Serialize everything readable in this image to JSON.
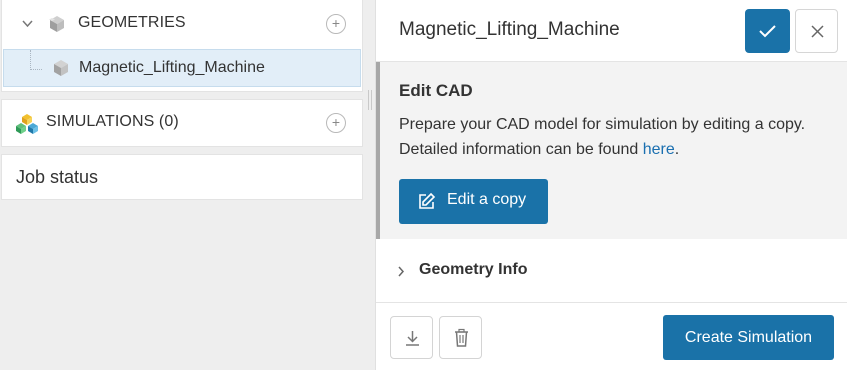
{
  "tree": {
    "geometries": {
      "label": "GEOMETRIES",
      "items": [
        {
          "label": "Magnetic_Lifting_Machine"
        }
      ]
    },
    "simulations": {
      "label": "SIMULATIONS (0)"
    },
    "job_status": {
      "label": "Job status"
    }
  },
  "panel": {
    "title": "Magnetic_Lifting_Machine",
    "edit_cad": {
      "title": "Edit CAD",
      "description": "Prepare your CAD model for simulation by editing a copy. Detailed information can be found ",
      "link_text": "here",
      "description_end": ".",
      "button_label": "Edit a copy"
    },
    "geometry_info": {
      "label": "Geometry Info"
    },
    "footer": {
      "create_label": "Create Simulation"
    }
  },
  "icons": {
    "confirm": "check-icon",
    "close": "close-icon",
    "download": "download-icon",
    "delete": "trash-icon",
    "edit": "edit-icon",
    "add": "plus-icon",
    "geometry": "cube-icon",
    "simulation": "simulation-cubes-icon"
  },
  "colors": {
    "primary": "#1a72a8",
    "link": "#1a6fb0",
    "selected_row": "#e2eef8",
    "section_bg": "#f3f3f3"
  }
}
